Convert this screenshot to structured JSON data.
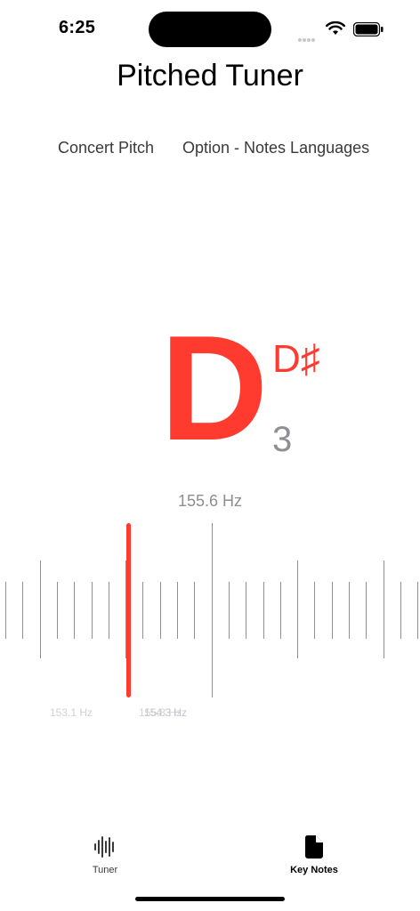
{
  "status_bar": {
    "time": "6:25",
    "icons": [
      "cellular-icon",
      "wifi-icon",
      "battery-icon"
    ]
  },
  "app": {
    "title": "Pitched Tuner"
  },
  "menu": {
    "concert_pitch": "Concert Pitch",
    "notes_languages": "Option - Notes Languages"
  },
  "note_display": {
    "note": "D",
    "alt_note": "D♯",
    "octave": "3",
    "frequency": "155.6 Hz"
  },
  "ruler": {
    "labels": [
      "153.1 Hz",
      "154.3 Hz",
      "155.8 Hz"
    ],
    "accent_color": "#ff3b30"
  },
  "tab_bar": {
    "tabs": [
      {
        "label": "Tuner",
        "icon": "waveform-icon",
        "selected": false
      },
      {
        "label": "Key Notes",
        "icon": "document-icon",
        "selected": true
      }
    ]
  },
  "colors": {
    "accent": "#ff3b30",
    "secondary_text": "#8e8e93"
  }
}
